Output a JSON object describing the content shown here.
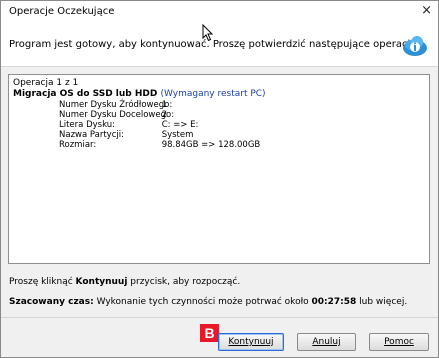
{
  "window": {
    "title": "Operacje Oczekujące",
    "close_glyph": "×"
  },
  "header": {
    "message": "Program jest gotowy, aby kontynuować. Proszę potwierdzić następujące operacje.",
    "icon": "info-cloud-icon"
  },
  "operation": {
    "counter": "Operacja 1 z 1",
    "title": "Migracja OS do SSD lub HDD",
    "note": "(Wymagany restart PC)",
    "rows": [
      {
        "key": "Numer Dysku Źródłowego:",
        "value": "1"
      },
      {
        "key": "Numer Dysku Docelowego:",
        "value": "2"
      },
      {
        "key": "Litera Dysku:",
        "value": "C: => E:"
      },
      {
        "key": "Nazwa Partycji:",
        "value": "System"
      },
      {
        "key": "Rozmiar:",
        "value": "98.84GB => 128.00GB"
      }
    ]
  },
  "footer": {
    "prompt_before": "Proszę kliknąć ",
    "prompt_bold": "Kontynuuj",
    "prompt_after": " przycisk, aby rozpocząć.",
    "estimate_label": "Szacowany czas:",
    "estimate_before": " Wykonanie tych czynności może potrwać około ",
    "estimate_time": "00:27:58",
    "estimate_after": " lub więcej."
  },
  "badge": "B",
  "buttons": {
    "continue": "Kontynuuj",
    "cancel": "Anuluj",
    "help": "Pomoc"
  },
  "colors": {
    "badge": "#e8172a",
    "note_blue": "#1c3fa9",
    "focus_border": "#2b6ad8"
  }
}
